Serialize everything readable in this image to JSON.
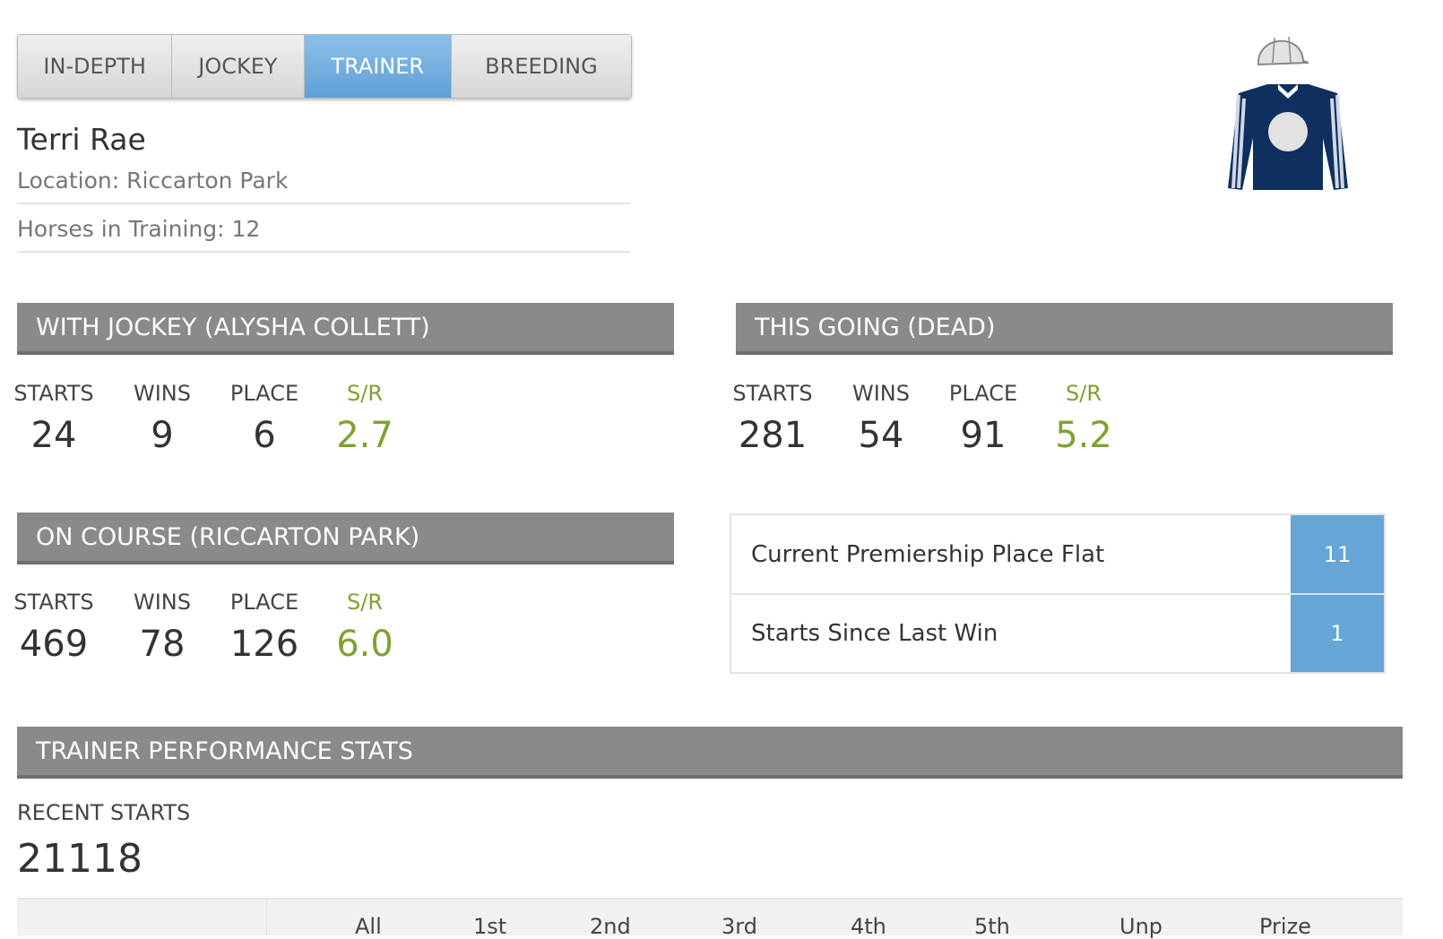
{
  "tabs": [
    {
      "label": "IN-DEPTH"
    },
    {
      "label": "JOCKEY"
    },
    {
      "label": "TRAINER"
    },
    {
      "label": "BREEDING"
    }
  ],
  "trainer": {
    "name": "Terri Rae",
    "location": "Location: Riccarton Park",
    "horses": "Horses in Training: 12"
  },
  "colors": {
    "accent": "#66a6d6",
    "sr_green": "#7ea22f",
    "header_grey": "#8a8a8a",
    "silks_navy": "#0f2f5f"
  },
  "sections": {
    "with_jockey": {
      "title": "WITH JOCKEY (ALYSHA COLLETT)",
      "starts_label": "STARTS",
      "starts": "24",
      "wins_label": "WINS",
      "wins": "9",
      "place_label": "PLACE",
      "place": "6",
      "sr_label": "S/R",
      "sr": "2.7"
    },
    "this_going": {
      "title": "THIS GOING (DEAD)",
      "starts_label": "STARTS",
      "starts": "281",
      "wins_label": "WINS",
      "wins": "54",
      "place_label": "PLACE",
      "place": "91",
      "sr_label": "S/R",
      "sr": "5.2"
    },
    "on_course": {
      "title": "ON COURSE (RICCARTON PARK)",
      "starts_label": "STARTS",
      "starts": "469",
      "wins_label": "WINS",
      "wins": "78",
      "place_label": "PLACE",
      "place": "126",
      "sr_label": "S/R",
      "sr": "6.0"
    }
  },
  "info_table": [
    {
      "label": "Current Premiership Place Flat",
      "value": "11"
    },
    {
      "label": "Starts Since Last Win",
      "value": "1"
    }
  ],
  "performance": {
    "title": "TRAINER PERFORMANCE STATS",
    "recent_label": "RECENT STARTS",
    "recent_value": "21118",
    "columns": [
      "All",
      "1st",
      "2nd",
      "3rd",
      "4th",
      "5th",
      "Unp",
      "Prize"
    ]
  }
}
